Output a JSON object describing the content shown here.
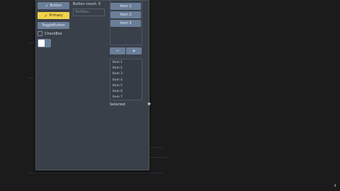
{
  "buttons": {
    "button_label": "Button",
    "primary_label": "Primary",
    "toggle_button_label": "ToggleButton",
    "check_glyph": "✓"
  },
  "button_count": "Button count: 0",
  "textbox": {
    "placeholder": "TextBox..."
  },
  "checkbox": {
    "label": "CheckBox",
    "checked": false
  },
  "toggle_switch": {
    "on": false
  },
  "listbox": {
    "items": [
      "Item 1",
      "Item 2",
      "Item 3"
    ]
  },
  "stepper": {
    "minus": "−",
    "plus": "+"
  },
  "small_list": {
    "items": [
      "Item 1",
      "Item 2",
      "Item 3",
      "Item 4",
      "Item 5",
      "Item 6",
      "Item 7"
    ]
  },
  "selected_label": "Selected",
  "cursor_glyph": "✥",
  "colors": {
    "window_bg": "#3a4049",
    "accent_button": "#6a7e98",
    "primary_button": "#f2d24a",
    "desktop_bg": "#1b1b1c"
  }
}
